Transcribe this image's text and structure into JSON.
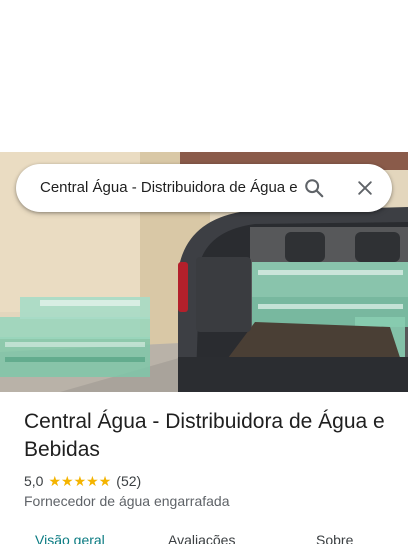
{
  "search": {
    "query": "Central Água - Distribuidora de Água e Bebidas"
  },
  "place": {
    "name": "Central Água - Distribuidora de Água e Bebidas",
    "rating": "5,0",
    "stars": 5,
    "review_count": "(52)",
    "category": "Fornecedor de água engarrafada"
  },
  "tabs": [
    {
      "label": "Visão geral",
      "active": true
    },
    {
      "label": "Avaliações",
      "active": false
    },
    {
      "label": "Sobre",
      "active": false
    }
  ],
  "colors": {
    "accent": "#0b7b82",
    "star": "#f4b400",
    "text_primary": "#1f1f1f",
    "text_secondary": "#5f6368"
  },
  "icons": [
    "search-icon",
    "close-icon",
    "star-icon"
  ]
}
